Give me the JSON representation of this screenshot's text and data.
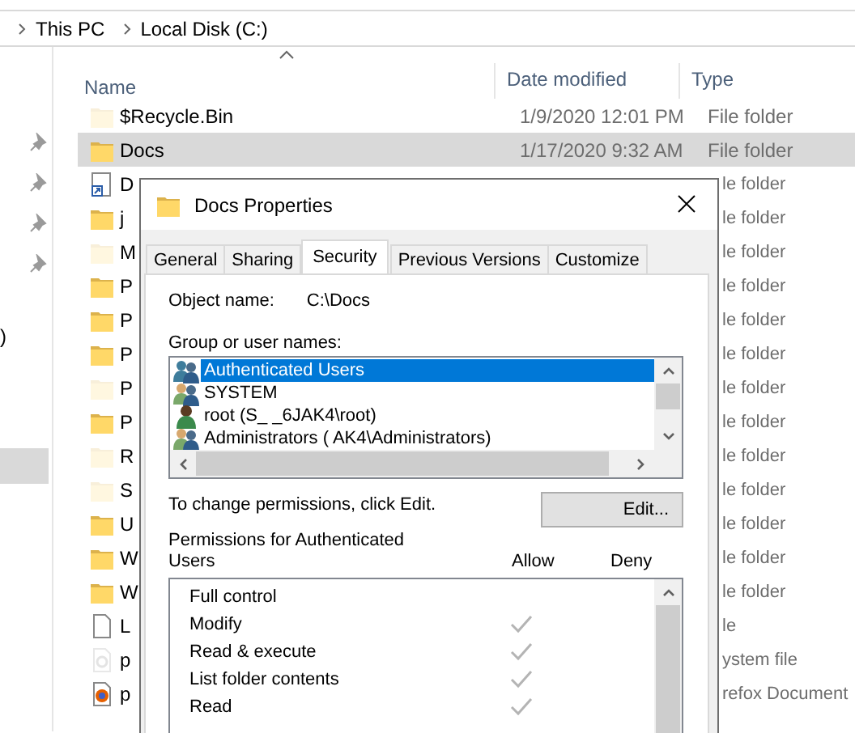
{
  "address_bar": {
    "breadcrumbs": [
      "This PC",
      "Local Disk (C:)"
    ]
  },
  "navigation": {
    "fragment": ")"
  },
  "file_list": {
    "columns": [
      "Name",
      "Date modified",
      "Type"
    ],
    "rows": [
      {
        "kind": "folder",
        "hidden": true,
        "name": "$Recycle.Bin",
        "date": "1/9/2020 12:01 PM",
        "type": "File folder",
        "selected": false
      },
      {
        "kind": "folder",
        "hidden": false,
        "name": "Docs",
        "date": "1/17/2020 9:32 AM",
        "type": "File folder",
        "selected": true
      },
      {
        "kind": "shortcut",
        "hidden": false,
        "name": "D",
        "type": "le folder",
        "selected": false
      },
      {
        "kind": "folder",
        "hidden": false,
        "name": "j",
        "type": "le folder",
        "selected": false
      },
      {
        "kind": "folder",
        "hidden": true,
        "name": "M",
        "type": "le folder",
        "selected": false
      },
      {
        "kind": "folder",
        "hidden": false,
        "name": "P",
        "type": "le folder",
        "selected": false
      },
      {
        "kind": "folder",
        "hidden": false,
        "name": "P",
        "type": "le folder",
        "selected": false
      },
      {
        "kind": "folder",
        "hidden": false,
        "name": "P",
        "type": "le folder",
        "selected": false
      },
      {
        "kind": "folder",
        "hidden": true,
        "name": "P",
        "type": "le folder",
        "selected": false
      },
      {
        "kind": "folder",
        "hidden": false,
        "name": "P",
        "type": "le folder",
        "selected": false
      },
      {
        "kind": "folder",
        "hidden": true,
        "name": "R",
        "type": "le folder",
        "selected": false
      },
      {
        "kind": "folder",
        "hidden": true,
        "name": "S",
        "type": "le folder",
        "selected": false
      },
      {
        "kind": "folder",
        "hidden": false,
        "name": "U",
        "type": "le folder",
        "selected": false
      },
      {
        "kind": "folder",
        "hidden": false,
        "name": "W",
        "type": "le folder",
        "selected": false
      },
      {
        "kind": "folder",
        "hidden": false,
        "name": "W",
        "type": "le folder",
        "selected": false
      },
      {
        "kind": "file",
        "hidden": false,
        "name": "L",
        "type": "le",
        "selected": false
      },
      {
        "kind": "system",
        "hidden": true,
        "name": "p",
        "type": "ystem file",
        "selected": false
      },
      {
        "kind": "firefox",
        "hidden": false,
        "name": "p",
        "type": "refox Document",
        "selected": false
      }
    ]
  },
  "dialog": {
    "title": "Docs Properties",
    "tabs": [
      {
        "label": "General",
        "selected": false
      },
      {
        "label": "Sharing",
        "selected": false
      },
      {
        "label": "Security",
        "selected": true
      },
      {
        "label": "Previous Versions",
        "selected": false
      },
      {
        "label": "Customize",
        "selected": false
      }
    ],
    "object_name_label": "Object name:",
    "object_name": "C:\\Docs",
    "group_label": "Group or user names:",
    "principals": [
      {
        "kind": "group",
        "name": "Authenticated Users",
        "selected": true
      },
      {
        "kind": "group",
        "name": "SYSTEM",
        "selected": false
      },
      {
        "kind": "user",
        "name": "root (S_ _6JAK4\\root)",
        "selected": false
      },
      {
        "kind": "group",
        "name": "Administrators (  AK4\\Administrators)",
        "selected": false
      }
    ],
    "edit_hint": "To change permissions, click Edit.",
    "edit_button": "Edit...",
    "permissions": {
      "label": "Permissions for Authenticated Users",
      "allow_label": "Allow",
      "deny_label": "Deny",
      "items": [
        {
          "name": "Full control",
          "allow": false,
          "deny": false
        },
        {
          "name": "Modify",
          "allow": true,
          "deny": false
        },
        {
          "name": "Read & execute",
          "allow": true,
          "deny": false
        },
        {
          "name": "List folder contents",
          "allow": true,
          "deny": false
        },
        {
          "name": "Read",
          "allow": true,
          "deny": false
        }
      ]
    }
  }
}
